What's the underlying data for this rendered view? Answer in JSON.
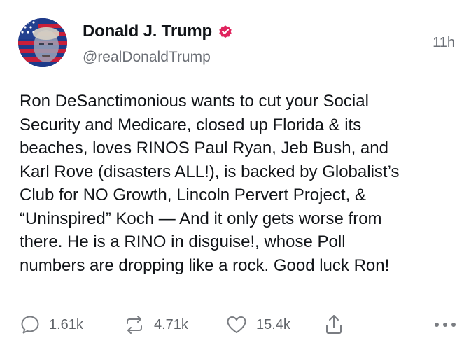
{
  "author": {
    "display_name": "Donald J. Trump",
    "handle": "@realDonaldTrump",
    "verified": true,
    "avatar_icon": "profile-photo-flag-icon"
  },
  "post": {
    "timestamp": "11h",
    "text": "Ron DeSanctimonious wants to cut your Social\nSecurity and Medicare, closed up Florida & its\nbeaches, loves RINOS Paul Ryan, Jeb Bush, and\nKarl Rove (disasters ALL!), is backed by Globalist’s\nClub for NO Growth, Lincoln Pervert Project, &\n“Uninspired” Koch — And it only gets worse from\nthere. He is a RINO in disguise!, whose Poll\nnumbers are dropping like a rock. Good luck Ron!"
  },
  "actions": {
    "reply_count": "1.61k",
    "repost_count": "4.71k",
    "like_count": "15.4k"
  },
  "colors": {
    "verified_badge": "#e0245e",
    "muted_text": "#6b6f76",
    "icon_gray": "#7a7d82"
  }
}
